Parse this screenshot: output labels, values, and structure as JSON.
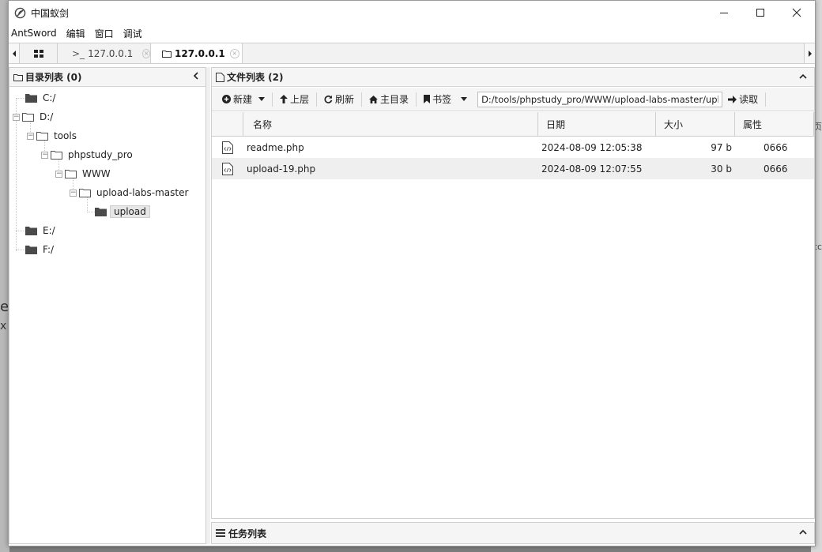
{
  "window": {
    "title": "中国蚁剑"
  },
  "menu": [
    "AntSword",
    "编辑",
    "窗口",
    "调试"
  ],
  "tabs": [
    {
      "label": "127.0.0.1",
      "prefix": ">_",
      "active": false
    },
    {
      "label": "127.0.0.1",
      "active": true
    }
  ],
  "left_panel": {
    "title": "目录列表 (0)",
    "tree": [
      {
        "label": "C:/",
        "level": 0
      },
      {
        "label": "D:/",
        "level": 0
      },
      {
        "label": "tools",
        "level": 1
      },
      {
        "label": "phpstudy_pro",
        "level": 2
      },
      {
        "label": "WWW",
        "level": 3
      },
      {
        "label": "upload-labs-master",
        "level": 4
      },
      {
        "label": "upload",
        "level": 5,
        "selected": true
      },
      {
        "label": "E:/",
        "level": 0
      },
      {
        "label": "F:/",
        "level": 0
      }
    ]
  },
  "right_panel": {
    "title": "文件列表 (2)",
    "toolbar": {
      "new": "新建",
      "up": "上层",
      "refresh": "刷新",
      "home": "主目录",
      "bookmark": "书签",
      "path": "D:/tools/phpstudy_pro/WWW/upload-labs-master/upload",
      "read": "读取"
    },
    "columns": [
      "名称",
      "日期",
      "大小",
      "属性"
    ],
    "files": [
      {
        "name": "readme.php",
        "date": "2024-08-09 12:05:38",
        "size": "97 b",
        "attr": "0666"
      },
      {
        "name": "upload-19.php",
        "date": "2024-08-09 12:07:55",
        "size": "30 b",
        "attr": "0666"
      }
    ]
  },
  "task_panel": {
    "title": "任务列表"
  },
  "colors": {
    "selected_bg": "#e6e6e6",
    "row_alt": "#efefef",
    "border": "#cfcfcf"
  }
}
